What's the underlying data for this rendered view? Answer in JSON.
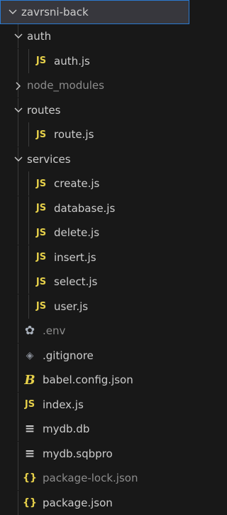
{
  "explorer": {
    "root": {
      "label": "zavrsni-back",
      "expanded": true
    },
    "items": [
      {
        "label": "auth",
        "type": "folder",
        "expanded": true,
        "depth": 1
      },
      {
        "label": "auth.js",
        "type": "file",
        "icon": "js-icon",
        "depth": 2
      },
      {
        "label": "node_modules",
        "type": "folder",
        "expanded": false,
        "depth": 1,
        "dim": true
      },
      {
        "label": "routes",
        "type": "folder",
        "expanded": true,
        "depth": 1
      },
      {
        "label": "route.js",
        "type": "file",
        "icon": "js-icon",
        "depth": 2
      },
      {
        "label": "services",
        "type": "folder",
        "expanded": true,
        "depth": 1
      },
      {
        "label": "create.js",
        "type": "file",
        "icon": "js-icon",
        "depth": 2
      },
      {
        "label": "database.js",
        "type": "file",
        "icon": "js-icon",
        "depth": 2
      },
      {
        "label": "delete.js",
        "type": "file",
        "icon": "js-icon",
        "depth": 2
      },
      {
        "label": "insert.js",
        "type": "file",
        "icon": "js-icon",
        "depth": 2
      },
      {
        "label": "select.js",
        "type": "file",
        "icon": "js-icon",
        "depth": 2
      },
      {
        "label": "user.js",
        "type": "file",
        "icon": "js-icon",
        "depth": 2
      },
      {
        "label": ".env",
        "type": "file",
        "icon": "gear-icon",
        "depth": 1,
        "dim": true
      },
      {
        "label": ".gitignore",
        "type": "file",
        "icon": "git-icon",
        "depth": 1
      },
      {
        "label": "babel.config.json",
        "type": "file",
        "icon": "babel-icon",
        "depth": 1
      },
      {
        "label": "index.js",
        "type": "file",
        "icon": "js-icon",
        "depth": 1
      },
      {
        "label": "mydb.db",
        "type": "file",
        "icon": "lines-icon",
        "depth": 1
      },
      {
        "label": "mydb.sqbpro",
        "type": "file",
        "icon": "lines-icon",
        "depth": 1
      },
      {
        "label": "package-lock.json",
        "type": "file",
        "icon": "json-icon",
        "depth": 1,
        "dim": true
      },
      {
        "label": "package.json",
        "type": "file",
        "icon": "json-icon",
        "depth": 1
      }
    ]
  },
  "icon_glyphs": {
    "js-icon": "JS",
    "gear-icon": "✿",
    "git-icon": "◈",
    "babel-icon": "B",
    "lines-icon": "≡",
    "json-icon": "{}"
  },
  "colors": {
    "background": "#181818",
    "selected_row": "#37373d",
    "focus_border": "#2b79d0",
    "text": "#cccccc",
    "dim_text": "#8c8c8c",
    "js_yellow": "#e6d04a"
  }
}
